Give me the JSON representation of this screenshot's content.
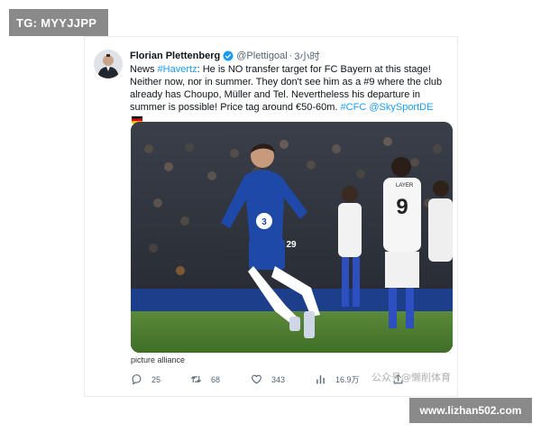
{
  "overlay": {
    "tg_badge": "TG: MYYJJPP",
    "site_badge": "www.lizhan502.com",
    "cn_watermark": "公众号@懒削体育"
  },
  "tweet": {
    "author_name": "Florian Plettenberg",
    "handle": "@Plettigoal",
    "separator": "·",
    "time": "3小时",
    "text": {
      "prefix": "News ",
      "hashtag_havertz": "#Havertz",
      "body": ": He is NO transfer target for FC Bayern at this stage! Neither now, nor in summer. They don't see him as a #9 where the club already has Choupo, Müller and Tel. Nevertheless his departure in summer is possible! Price tag around €50-60m. ",
      "hashtag_cfc": "#CFC",
      "mention_sky": "@SkySportDE"
    },
    "media": {
      "player_left_number": "29",
      "player_right_number": "9",
      "player_right_name": "LAYER",
      "credit": "picture alliance"
    },
    "actions": {
      "replies": "25",
      "retweets": "68",
      "likes": "343",
      "views": "16.9万"
    },
    "icons": [
      "verified-icon",
      "reply-icon",
      "retweet-icon",
      "like-icon",
      "views-icon",
      "share-icon",
      "flag-germany-icon"
    ],
    "colors": {
      "link": "#1d9bf0",
      "text": "#0f1419",
      "muted": "#536471",
      "chelsea_blue": "#1f49a8"
    }
  }
}
